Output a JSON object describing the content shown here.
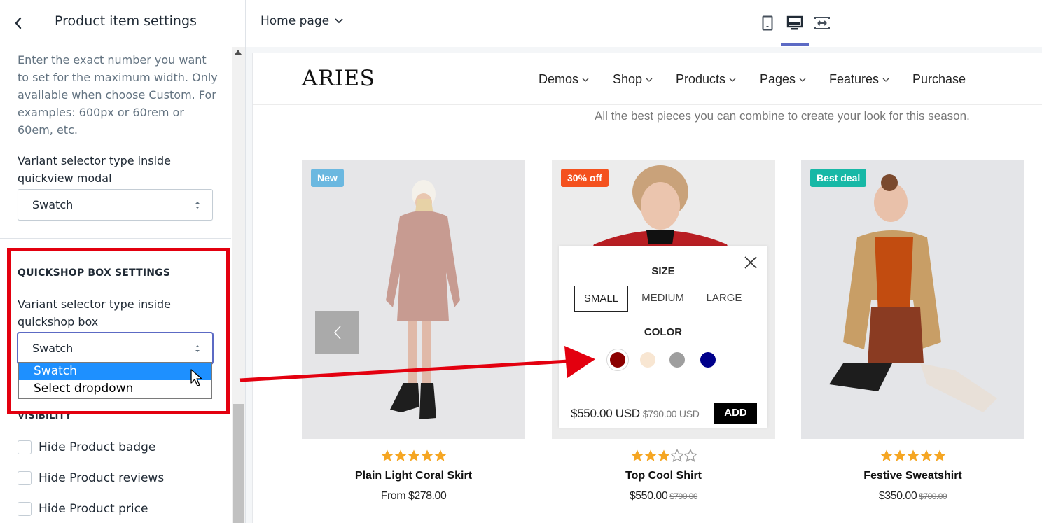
{
  "sidebar": {
    "title": "Product item settings",
    "help_text": "Enter the exact number you want to set for the maximum width. Only available when choose Custom. For examples: 600px or 60rem or 60em, etc.",
    "quickview_label": "Variant selector type inside quickview modal",
    "quickview_value": "Swatch",
    "quickshop_section": "QUICKSHOP BOX SETTINGS",
    "quickshop_label": "Variant selector type inside quickshop box",
    "quickshop_value": "Swatch",
    "dropdown_options": [
      "Swatch",
      "Select dropdown"
    ],
    "dropdown_selected": "Swatch",
    "visibility_section": "VISIBILITY",
    "checkboxes": [
      {
        "label": "Hide Product badge",
        "checked": false
      },
      {
        "label": "Hide Product reviews",
        "checked": false
      },
      {
        "label": "Hide Product price",
        "checked": false
      }
    ]
  },
  "topbar": {
    "page": "Home page",
    "devices": [
      "mobile-icon",
      "desktop-icon",
      "fullwidth-icon"
    ],
    "active_device": "desktop"
  },
  "store": {
    "logo": "ARIES",
    "nav": [
      {
        "label": "Demos"
      },
      {
        "label": "Shop"
      },
      {
        "label": "Products"
      },
      {
        "label": "Pages"
      },
      {
        "label": "Features"
      },
      {
        "label": "Purchase"
      }
    ],
    "tagline": "All the best pieces you can combine to create your look for this season.",
    "products": [
      {
        "badge": "New",
        "badge_color": "#6bb8e0",
        "rating": 5,
        "name": "Plain Light Coral Skirt",
        "price": "From $278.00",
        "old_price": ""
      },
      {
        "badge": "30% off",
        "badge_color": "#f4511e",
        "rating": 3,
        "name": "Top Cool Shirt",
        "price": "$550.00",
        "old_price": "$790.00"
      },
      {
        "badge": "Best deal",
        "badge_color": "#17b8a6",
        "rating": 5,
        "name": "Festive Sweatshirt",
        "price": "$350.00",
        "old_price": "$700.00"
      }
    ]
  },
  "quickshop": {
    "size_label": "SIZE",
    "sizes": [
      "SMALL",
      "MEDIUM",
      "LARGE"
    ],
    "selected_size": "SMALL",
    "color_label": "COLOR",
    "colors": [
      "#8b0000",
      "#f8e6d2",
      "#9e9e9e",
      "#00008b"
    ],
    "selected_color": "#8b0000",
    "price": "$550.00 USD",
    "old_price": "$790.00 USD",
    "add_label": "ADD"
  },
  "colors": {
    "accent": "#5c6ac4",
    "highlight_box": "#e3000f",
    "star": "#f5a623"
  }
}
